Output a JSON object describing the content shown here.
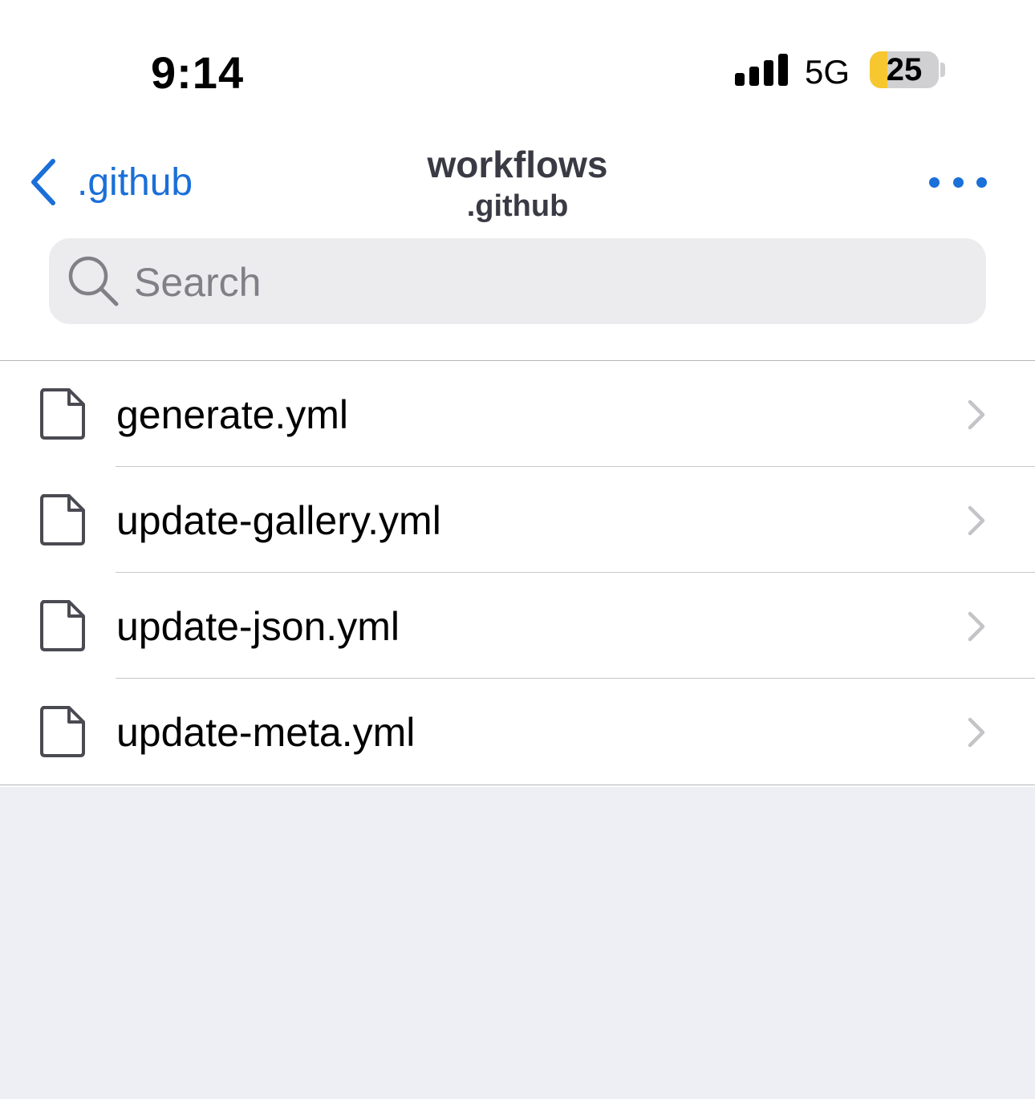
{
  "status_bar": {
    "time": "9:14",
    "network": "5G",
    "battery_level": "25",
    "battery_fraction": 0.25,
    "battery_color": "#f7c72f",
    "signal_icon": "cellular-signal-icon"
  },
  "nav": {
    "back_label": ".github",
    "title": "workflows",
    "subtitle": ".github",
    "more_icon": "ellipsis-icon",
    "accent_color": "#1a6fd8"
  },
  "search": {
    "placeholder": "Search"
  },
  "files": [
    {
      "name": "generate.yml",
      "icon": "file-icon"
    },
    {
      "name": "update-gallery.yml",
      "icon": "file-icon"
    },
    {
      "name": "update-json.yml",
      "icon": "file-icon"
    },
    {
      "name": "update-meta.yml",
      "icon": "file-icon"
    }
  ]
}
